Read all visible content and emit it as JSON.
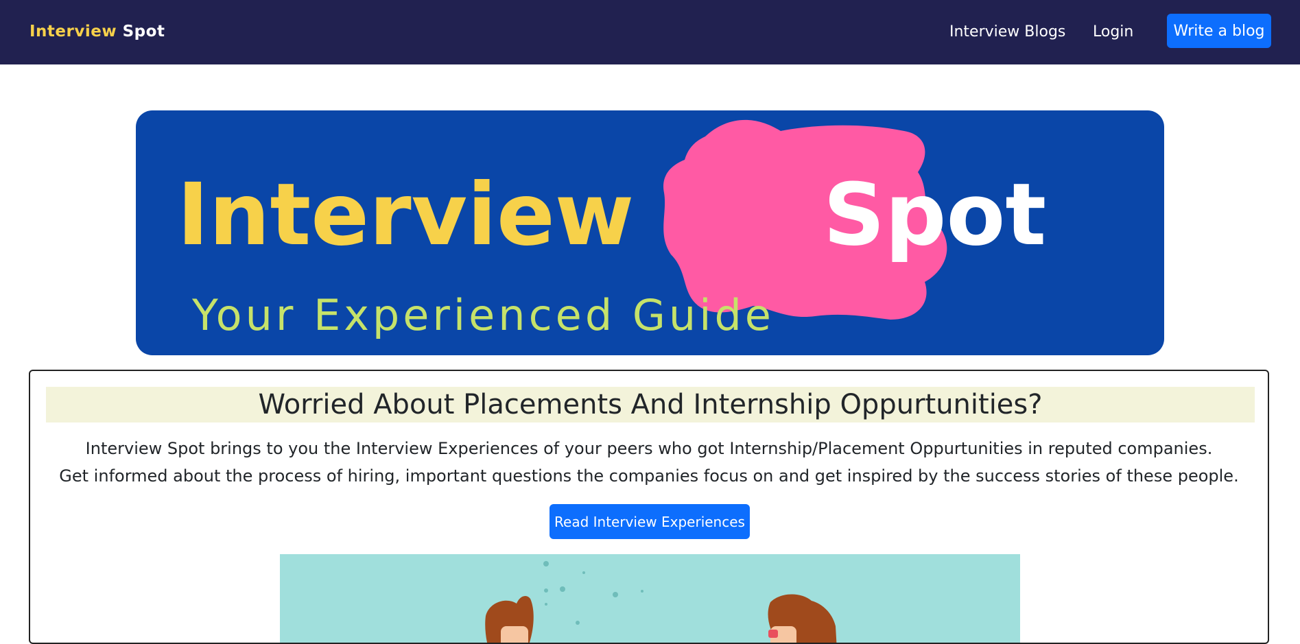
{
  "navbar": {
    "brand_part1": "Interview",
    "brand_part2": "Spot",
    "links": [
      "Interview Blogs",
      "Login"
    ],
    "cta": "Write a blog"
  },
  "hero": {
    "title_part1": "Interview",
    "title_part2": "Spot",
    "tagline": "Your Experienced Guide"
  },
  "intro": {
    "headline": "Worried About Placements And Internship Oppurtunities?",
    "line1": "Interview Spot brings to you the Interview Experiences of your peers who got Internship/Placement Oppurtunities in reputed companies.",
    "line2": "Get informed about the process of hiring, important questions the companies focus on and get inspired by the success stories of these people.",
    "button": "Read Interview Experiences"
  },
  "colors": {
    "navbar_bg": "#212150",
    "brand_yellow": "#f7d14a",
    "primary_button": "#0d6efd",
    "hero_bg": "#0a46a8",
    "splash_pink": "#ff5aa4",
    "tagline_green": "#c6e26a",
    "headline_bg": "#f3f3da",
    "illustration_bg": "#a0dfdc"
  }
}
